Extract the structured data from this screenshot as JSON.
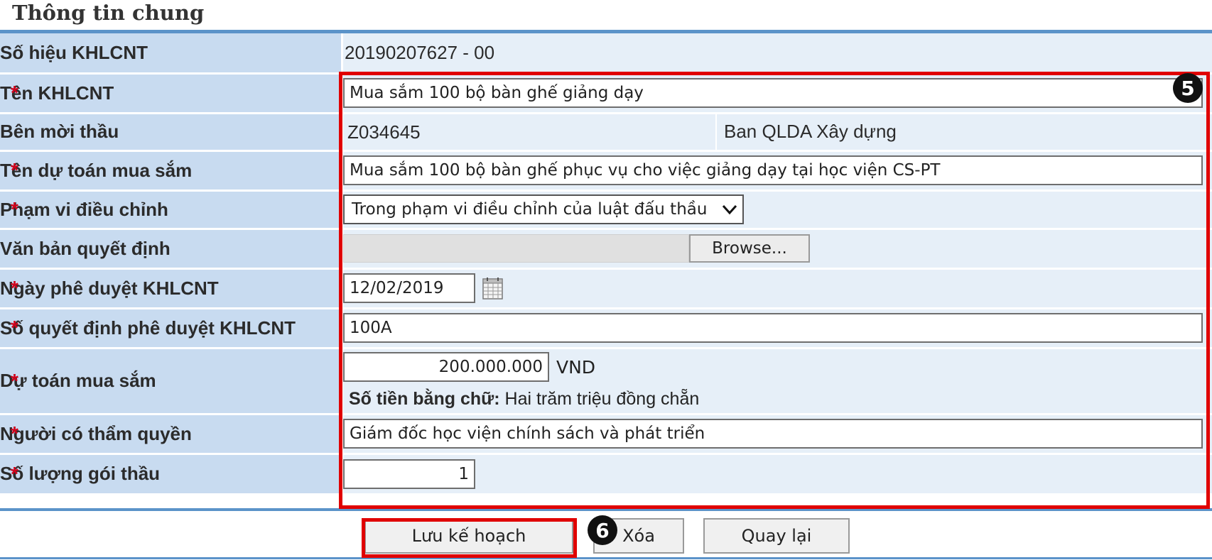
{
  "section_title": "Thông tin chung",
  "fields": {
    "so_hieu": {
      "label": "Số hiệu KHLCNT",
      "value": "20190207627 - 00"
    },
    "ten_khlcnt": {
      "label": "Tên KHLCNT",
      "value": "Mua sắm 100 bộ bàn ghế giảng dạy"
    },
    "ben_moi_thau": {
      "label": "Bên mời thầu",
      "code": "Z034645",
      "name": "Ban QLDA Xây dựng"
    },
    "ten_du_toan": {
      "label": "Tên dự toán mua sắm",
      "value": "Mua sắm 100 bộ bàn ghế phục vụ cho việc giảng dạy tại học viện CS-PT"
    },
    "pham_vi": {
      "label": "Phạm vi điều chỉnh",
      "selected": "Trong phạm vi điều chỉnh của luật đấu thầu"
    },
    "van_ban": {
      "label": "Văn bản quyết định",
      "browse_label": "Browse..."
    },
    "ngay_phe_duyet": {
      "label": "Ngày phê duyệt KHLCNT",
      "value": "12/02/2019"
    },
    "so_quyet_dinh": {
      "label": "Số quyết định phê duyệt KHLCNT",
      "value": "100A"
    },
    "du_toan": {
      "label": "Dự toán mua sắm",
      "value": "200.000.000",
      "currency": "VND",
      "words_label": "Số tiền bằng chữ:",
      "words_value": "Hai trăm triệu đồng chẵn"
    },
    "nguoi_tham_quyen": {
      "label": "Người có thẩm quyền",
      "value": "Giám đốc học viện chính sách và phát triển"
    },
    "so_luong_goi": {
      "label": "Số lượng gói thầu",
      "value": "1"
    }
  },
  "required_mark": "*",
  "buttons": {
    "save": "Lưu kế hoạch",
    "delete": "Xóa",
    "back": "Quay lại"
  },
  "annotations": {
    "badge_form": "5",
    "badge_save": "6",
    "highlight_color": "#e00000"
  },
  "colors": {
    "label_bg": "#c8dbf0",
    "value_bg": "#e6eff8",
    "rule": "#5b93c9",
    "required": "#d0021b"
  }
}
